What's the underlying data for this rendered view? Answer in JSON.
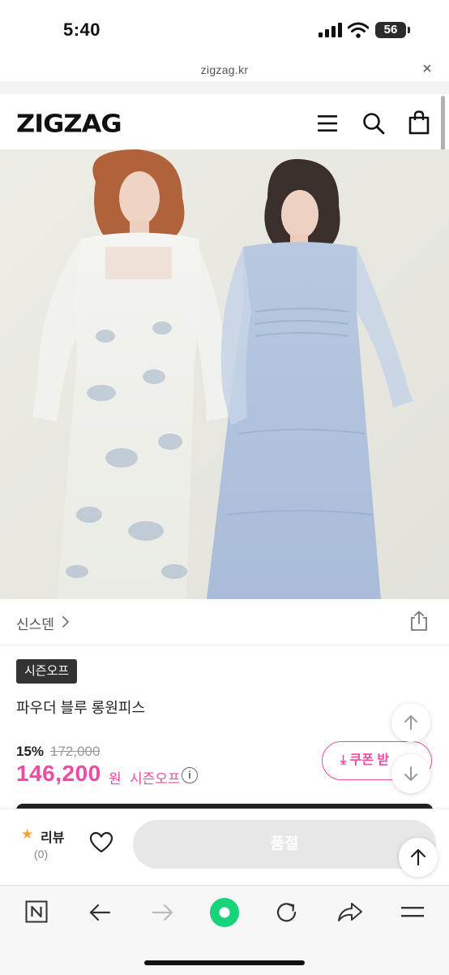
{
  "status_bar": {
    "time": "5:40",
    "battery": "56"
  },
  "url_bar": {
    "domain": "zigzag.kr",
    "close_icon": "×"
  },
  "header": {
    "logo": "ZIGZAG",
    "icons": [
      "menu-icon",
      "search-icon",
      "shopping-bag-icon"
    ]
  },
  "product": {
    "brand": "신스덴",
    "badge": "시즌오프",
    "name": "파우더 블루 롱원피스",
    "discount_rate": "15%",
    "original_price": "172,000",
    "sale_price": "146,200",
    "currency": "원",
    "sale_label": "시즌오프",
    "coupon_label": "쿠폰 받"
  },
  "action_bar": {
    "review_label": "리뷰",
    "review_count": "(0)",
    "soldout_label": "품절"
  },
  "browser_toolbar": {
    "icons": [
      "naver-n-icon",
      "back-arrow-icon",
      "forward-arrow-icon",
      "green-dot-icon",
      "reload-icon",
      "share-icon",
      "menu-lines-icon"
    ]
  },
  "colors": {
    "accent": "#f04ba0",
    "dark": "#333333",
    "soldout": "#e7e7e7",
    "green": "#17d37a"
  }
}
